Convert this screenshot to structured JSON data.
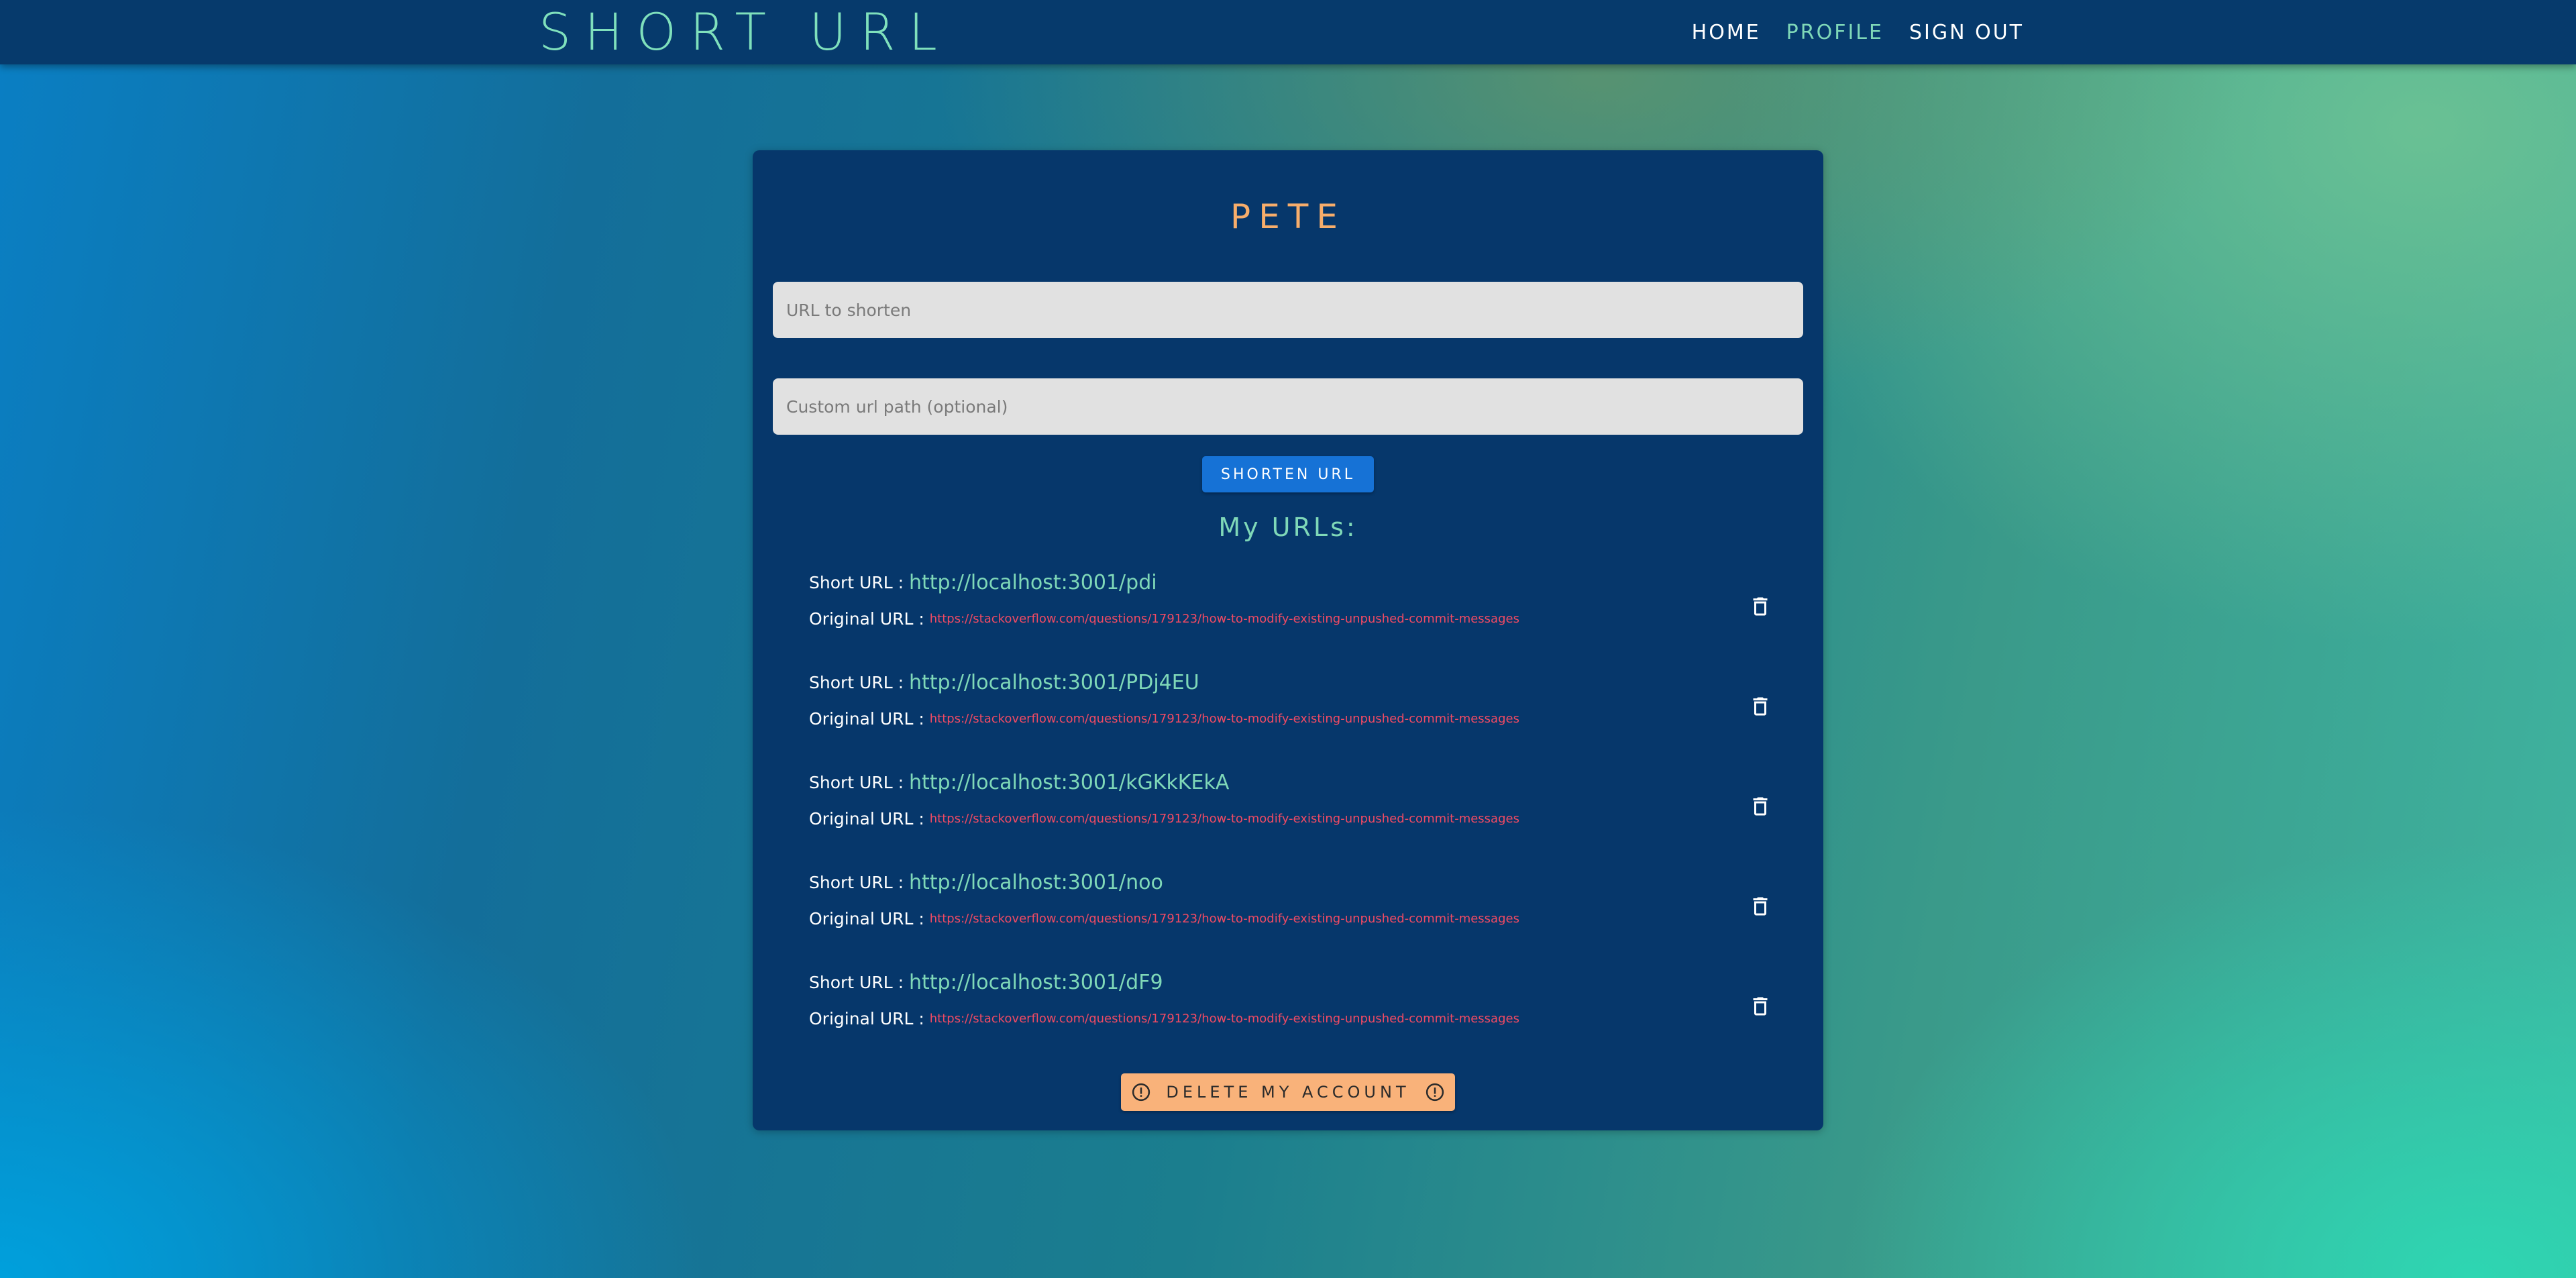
{
  "header": {
    "brand": "SHORT URL",
    "nav": [
      {
        "label": "HOME"
      },
      {
        "label": "PROFILE"
      },
      {
        "label": "SIGN OUT"
      }
    ]
  },
  "profile": {
    "username": "PETE",
    "url_input_placeholder": "URL to shorten",
    "custom_path_placeholder": "Custom url path (optional)",
    "shorten_button": "SHORTEN URL",
    "list_heading": "My URLs:",
    "short_label": "Short URL :",
    "original_label": "Original URL :",
    "urls": [
      {
        "short": "http://localhost:3001/pdi",
        "original": "https://stackoverflow.com/questions/179123/how-to-modify-existing-unpushed-commit-messages"
      },
      {
        "short": "http://localhost:3001/PDj4EU",
        "original": "https://stackoverflow.com/questions/179123/how-to-modify-existing-unpushed-commit-messages"
      },
      {
        "short": "http://localhost:3001/kGKkKEkA",
        "original": "https://stackoverflow.com/questions/179123/how-to-modify-existing-unpushed-commit-messages"
      },
      {
        "short": "http://localhost:3001/noo",
        "original": "https://stackoverflow.com/questions/179123/how-to-modify-existing-unpushed-commit-messages"
      },
      {
        "short": "http://localhost:3001/dF9",
        "original": "https://stackoverflow.com/questions/179123/how-to-modify-existing-unpushed-commit-messages"
      }
    ],
    "delete_account_button": "DELETE MY ACCOUNT"
  },
  "icons": {
    "delete": "trash-icon",
    "alert": "alert-circle-icon"
  },
  "colors": {
    "navbar": "#063a6c",
    "card": "#06376b",
    "accent_mint": "#7fd8b8",
    "username": "#f7ad6b",
    "primary_button": "#1672d6",
    "danger_button": "#f9b27a",
    "original_link": "#f14a63"
  }
}
